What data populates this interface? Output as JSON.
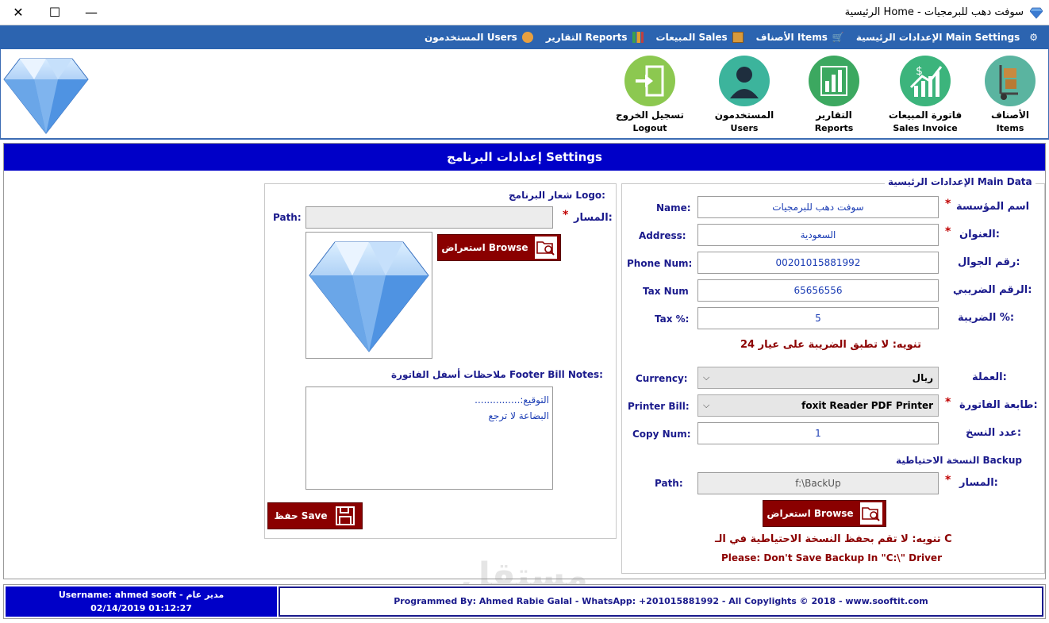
{
  "window": {
    "title": "الرئيسية Home - سوفت دهب للبرمجيات",
    "minimize_glyph": "—",
    "maximize_glyph": "☐",
    "close_glyph": "✕"
  },
  "menu": {
    "items": [
      {
        "label": "الإعدادات الرئيسية Main Settings",
        "icon": "settings-icon"
      },
      {
        "label": "الأصناف Items",
        "icon": "cart-icon"
      },
      {
        "label": "المبيعات Sales",
        "icon": "box-icon"
      },
      {
        "label": "التقارير Reports",
        "icon": "report-icon"
      },
      {
        "label": "المستخدمون Users",
        "icon": "users-icon"
      }
    ]
  },
  "toolbar": {
    "items_ar": "الأصناف",
    "items_en": "Items",
    "sales_ar": "فاتورة المبيعات",
    "sales_en": "Sales Invoice",
    "reports_ar": "التقارير",
    "reports_en": "Reports",
    "users_ar": "المستخدمون",
    "users_en": "Users",
    "logout_ar": "تسجيل الخروج",
    "logout_en": "Logout"
  },
  "header": {
    "title": "إعدادات البرنامج Settings"
  },
  "main_data": {
    "group_title": "الإعدادات الرئيسية Main Data",
    "name_en": "Name:",
    "name_ar": "اسم المؤسسة",
    "name_value": "سوفت دهب للبرمجيات",
    "address_en": "Address:",
    "address_ar": "العنوان:",
    "address_value": "السعودية",
    "phone_en": "Phone Num:",
    "phone_ar": "رقم الجوال:",
    "phone_value": "00201015881992",
    "taxnum_en": "Tax Num",
    "taxnum_ar": "الرقم الضريبي:",
    "taxnum_value": "65656556",
    "tax_en": "Tax %:",
    "tax_ar": "الضريبة %:",
    "tax_value": "5",
    "tax_note": "تنويه: لا تطبق الضريبة على عيار 24",
    "currency_en": "Currency:",
    "currency_ar": "العملة:",
    "currency_value": "ريال",
    "printer_en": "Printer Bill:",
    "printer_ar": "طابعة الفاتورة:",
    "printer_value": "foxit Reader PDF Printer",
    "copy_en": "Copy Num:",
    "copy_ar": "عدد النسخ:",
    "copy_value": "1",
    "required_mark": "*"
  },
  "backup": {
    "group_title": "النسخة الاحتياطية Backup",
    "path_en": "Path:",
    "path_ar": "المسار:",
    "path_value": "f:\\BackUp",
    "browse_label": "استعراض Browse",
    "note_ar": "تنويه: لا تقم بحفظ النسخة الاحتياطية في الـ C",
    "note_en": "Please: Don't Save Backup In \"C:\\\" Driver"
  },
  "logo": {
    "group_title": "شعار البرنامج Logo:",
    "path_en": "Path:",
    "path_ar": "المسار:",
    "path_value": "",
    "browse_label": "استعراض Browse"
  },
  "footer_notes": {
    "title": "ملاحظات أسفل الفاتورة Footer Bill Notes:",
    "line1": "التوقيع:...............",
    "line2": "البضاعة لا ترجع"
  },
  "save_label": "حفظ Save",
  "status": {
    "user_line": "Username: ahmed sooft - مدير عام",
    "datetime": "02/14/2019 01:12:27",
    "programmed": "Programmed By: Ahmed Rabie Galal - WhatsApp: +201015881992 - All Copylights © 2018 - www.sooftit.com"
  },
  "watermark": "مستقل",
  "colors": {
    "menubar": "#2c64b0",
    "header": "#0000c8",
    "button_red": "#8a0000",
    "label_blue": "#1a1a8c",
    "note_red": "#8c0000"
  }
}
